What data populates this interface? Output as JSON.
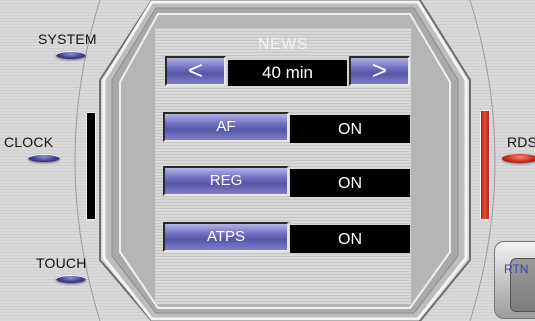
{
  "left_controls": {
    "system_label": "SYSTEM",
    "clock_label": "CLOCK",
    "touch_label": "TOUCH"
  },
  "right_controls": {
    "rds_label": "RDS",
    "rtn_label": "RTN"
  },
  "news": {
    "title": "NEWS",
    "value": "40 min",
    "prev_symbol": "<",
    "next_symbol": ">"
  },
  "settings": [
    {
      "label": "AF",
      "value": "ON"
    },
    {
      "label": "REG",
      "value": "ON"
    },
    {
      "label": "ATPS",
      "value": "ON"
    }
  ],
  "colors": {
    "button_blue": "#6b6bc0",
    "indicator_red": "#d8382a",
    "indicator_black": "#000000",
    "value_box_bg": "#000000"
  }
}
